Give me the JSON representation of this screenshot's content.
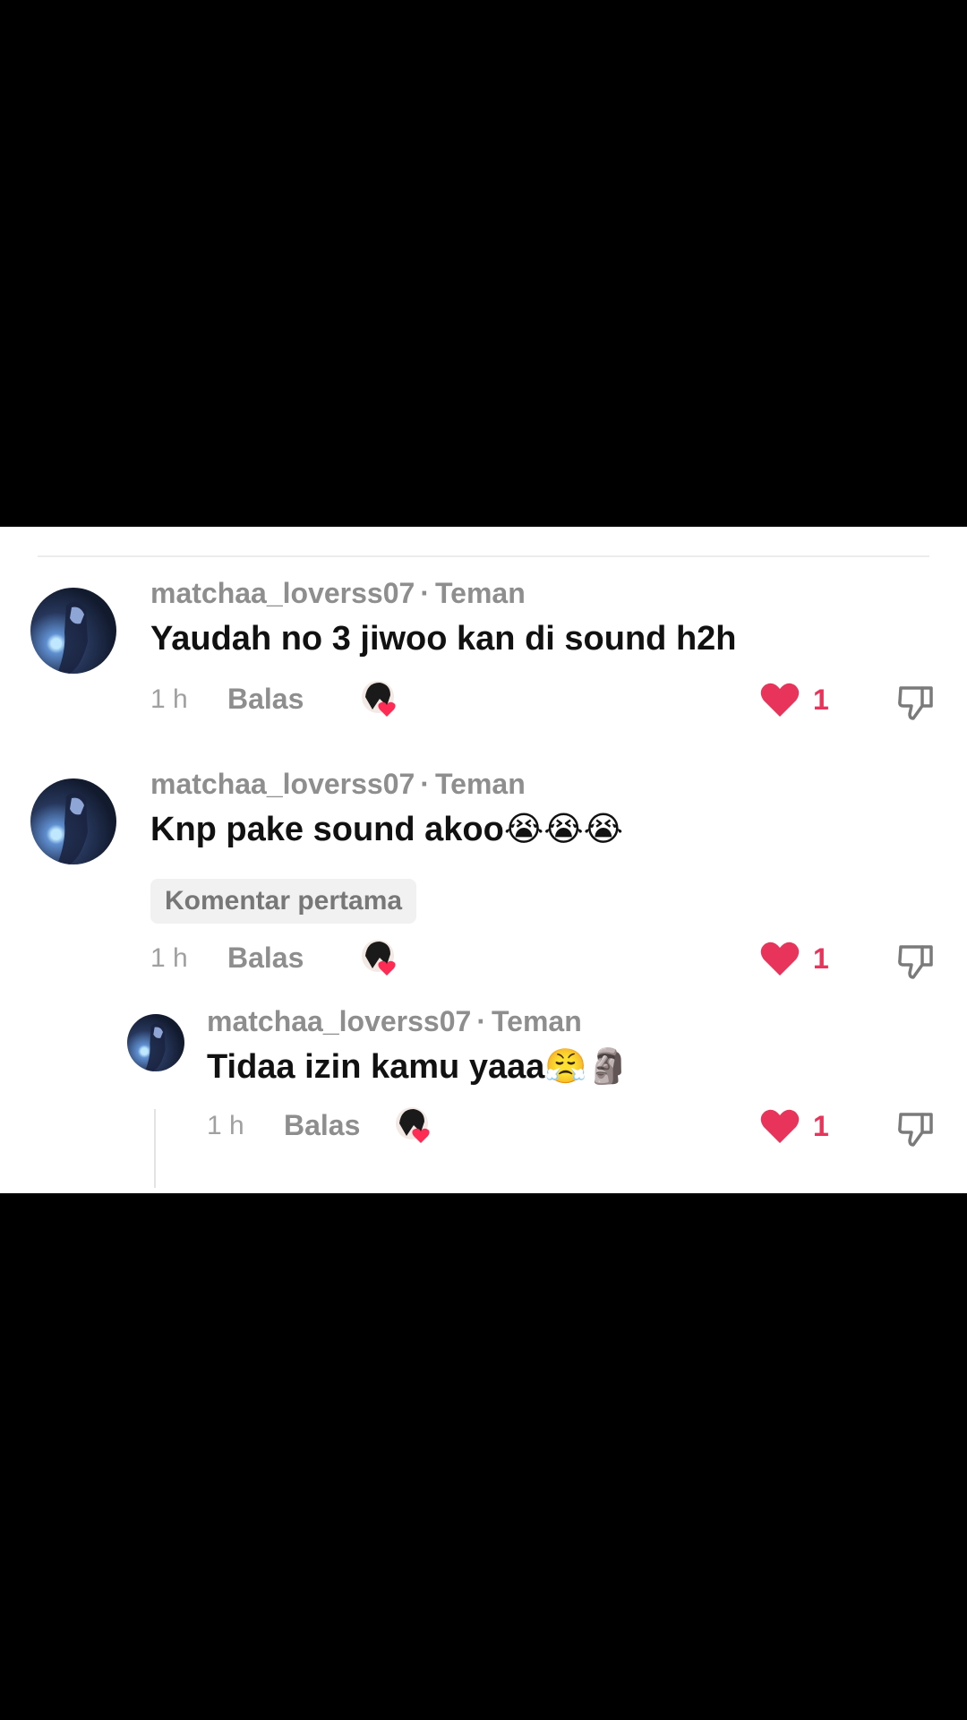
{
  "colors": {
    "like": "#e8345a",
    "meta": "#8e8e8e",
    "text": "#111111"
  },
  "comments": [
    {
      "username": "matchaa_loverss07",
      "relation": "Teman",
      "text": "Yaudah no 3 jiwoo kan di sound h2h",
      "emoji": "",
      "time": "1 h",
      "reply_label": "Balas",
      "likes": "1"
    },
    {
      "username": "matchaa_loverss07",
      "relation": "Teman",
      "text": "Knp pake sound akoo",
      "emoji": "😭😭😭",
      "badge": "Komentar pertama",
      "time": "1 h",
      "reply_label": "Balas",
      "likes": "1"
    },
    {
      "username": "matchaa_loverss07",
      "relation": "Teman",
      "text": "Tidaa izin kamu yaaa",
      "emoji": "😤🗿",
      "time": "1 h",
      "reply_label": "Balas",
      "likes": "1"
    }
  ],
  "icons": {
    "avatar": "user-avatar-icon",
    "creator_liked": "creator-liked-icon",
    "like": "heart-icon",
    "dislike": "thumbs-down-icon"
  }
}
